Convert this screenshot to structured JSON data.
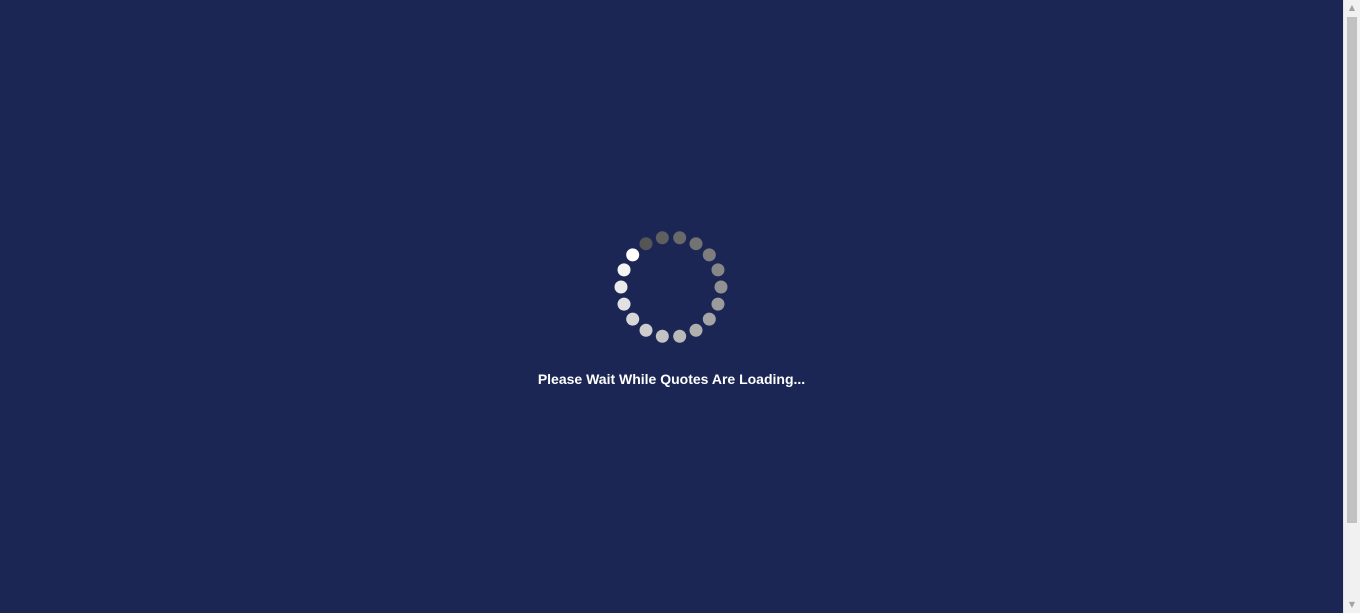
{
  "loading": {
    "message": "Please Wait While Quotes Are Loading..."
  },
  "spinner": {
    "dot_count": 18,
    "colors": {
      "background": "#1b2654",
      "dot_brightest": "#ffffff",
      "dot_darkest": "#555555"
    }
  },
  "scrollbar": {
    "up_icon": "▲",
    "down_icon": "▼"
  }
}
